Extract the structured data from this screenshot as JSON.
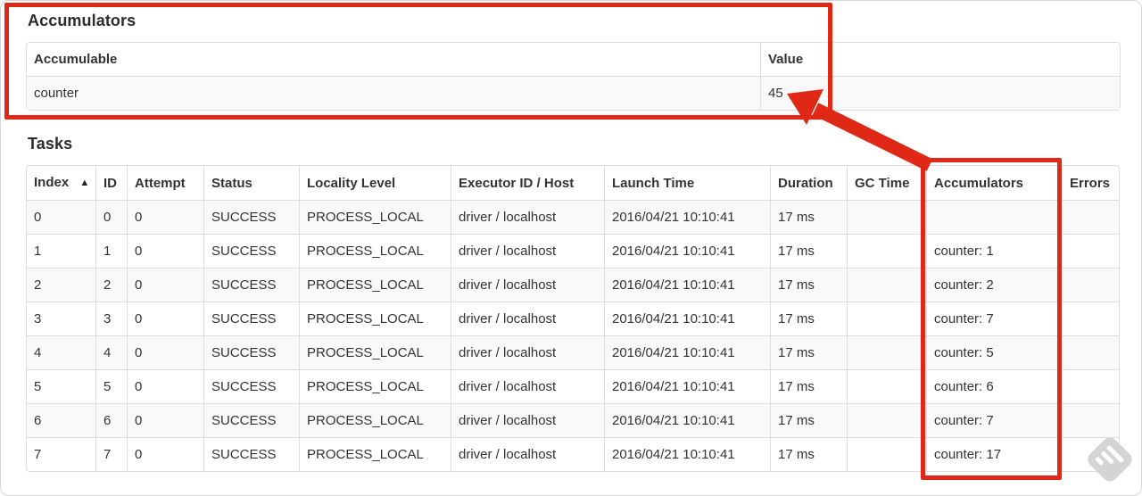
{
  "colors": {
    "annotation_red": "#e02817",
    "row_stripe": "#f9f9f9",
    "table_border": "#dddddd"
  },
  "accumulators_section": {
    "title": "Accumulators",
    "table": {
      "headers": [
        "Accumulable",
        "Value"
      ],
      "rows": [
        [
          "counter",
          "45"
        ]
      ]
    }
  },
  "tasks_section": {
    "title": "Tasks",
    "sort_icon": "▲",
    "sorted_column": "Index",
    "table": {
      "headers": [
        "Index",
        "ID",
        "Attempt",
        "Status",
        "Locality Level",
        "Executor ID / Host",
        "Launch Time",
        "Duration",
        "GC Time",
        "Accumulators",
        "Errors"
      ],
      "rows": [
        [
          "0",
          "0",
          "0",
          "SUCCESS",
          "PROCESS_LOCAL",
          "driver / localhost",
          "2016/04/21 10:10:41",
          "17 ms",
          "",
          "",
          ""
        ],
        [
          "1",
          "1",
          "0",
          "SUCCESS",
          "PROCESS_LOCAL",
          "driver / localhost",
          "2016/04/21 10:10:41",
          "17 ms",
          "",
          "counter: 1",
          ""
        ],
        [
          "2",
          "2",
          "0",
          "SUCCESS",
          "PROCESS_LOCAL",
          "driver / localhost",
          "2016/04/21 10:10:41",
          "17 ms",
          "",
          "counter: 2",
          ""
        ],
        [
          "3",
          "3",
          "0",
          "SUCCESS",
          "PROCESS_LOCAL",
          "driver / localhost",
          "2016/04/21 10:10:41",
          "17 ms",
          "",
          "counter: 7",
          ""
        ],
        [
          "4",
          "4",
          "0",
          "SUCCESS",
          "PROCESS_LOCAL",
          "driver / localhost",
          "2016/04/21 10:10:41",
          "17 ms",
          "",
          "counter: 5",
          ""
        ],
        [
          "5",
          "5",
          "0",
          "SUCCESS",
          "PROCESS_LOCAL",
          "driver / localhost",
          "2016/04/21 10:10:41",
          "17 ms",
          "",
          "counter: 6",
          ""
        ],
        [
          "6",
          "6",
          "0",
          "SUCCESS",
          "PROCESS_LOCAL",
          "driver / localhost",
          "2016/04/21 10:10:41",
          "17 ms",
          "",
          "counter: 7",
          ""
        ],
        [
          "7",
          "7",
          "0",
          "SUCCESS",
          "PROCESS_LOCAL",
          "driver / localhost",
          "2016/04/21 10:10:41",
          "17 ms",
          "",
          "counter: 17",
          ""
        ]
      ]
    }
  }
}
